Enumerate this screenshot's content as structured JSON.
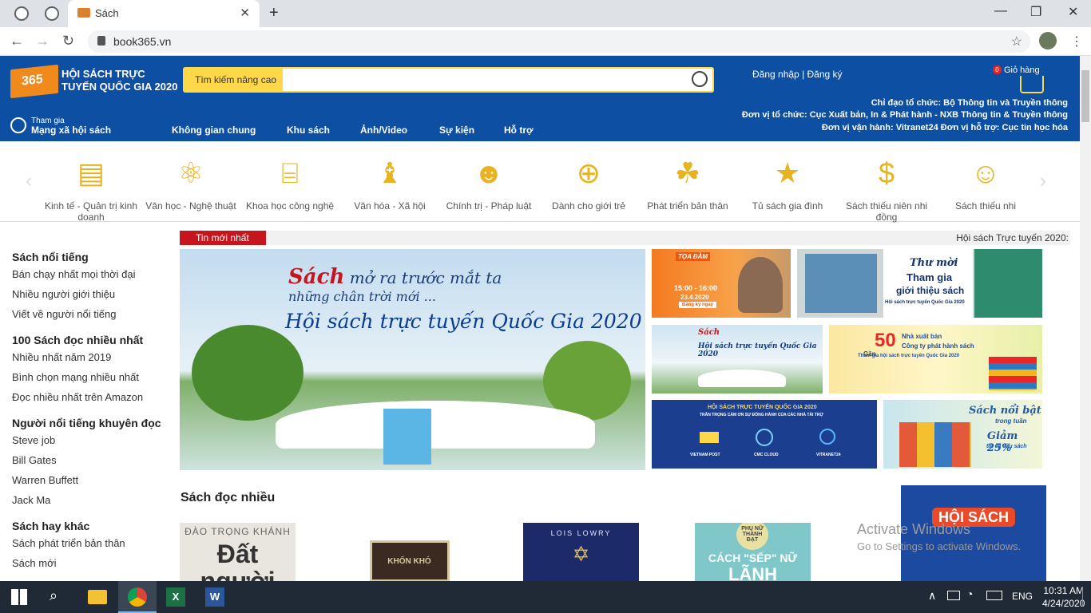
{
  "browser": {
    "tab_title": "Sách",
    "url": "book365.vn"
  },
  "header": {
    "logo": "book365.vn",
    "site_name": "HỘI SÁCH TRỰC TUYẾN QUỐC GIA 2020",
    "adv_search": "Tìm kiếm nâng cao",
    "login": "Đăng nhập",
    "register": "Đăng ký",
    "cart_count": "0",
    "cart_label": "Giỏ hàng",
    "org1": "Chỉ đạo tổ chức: Bộ Thông tin và Truyền thông",
    "org2": "Đơn vị tổ chức: Cục Xuất bản, In & Phát hành - NXB Thông tin & Truyền thông",
    "org3": "Đơn vị vận hành: Vitranet24   Đơn vị hỗ trợ: Cục tin học hóa",
    "join_small": "Tham gia",
    "join_big": "Mạng xã hội sách",
    "nav": [
      "Không gian chung",
      "Khu sách",
      "Ảnh/Video",
      "Sự kiện",
      "Hỗ trợ"
    ]
  },
  "categories": [
    {
      "label": "Kinh tế - Quản trị kinh doanh",
      "icon": "book-icon"
    },
    {
      "label": "Văn học - Nghệ thuật",
      "icon": "atom-icon"
    },
    {
      "label": "Khoa học công nghệ",
      "icon": "column-icon"
    },
    {
      "label": "Văn hóa - Xã hội",
      "icon": "chess-icon"
    },
    {
      "label": "Chính trị - Pháp luật",
      "icon": "person-icon"
    },
    {
      "label": "Dành cho giới trẻ",
      "icon": "globe-book-icon"
    },
    {
      "label": "Phát triển bản thân",
      "icon": "people-icon"
    },
    {
      "label": "Tủ sách gia đình",
      "icon": "star-icon"
    },
    {
      "label": "Sách thiếu niên nhi đồng",
      "icon": "money-hand-icon"
    },
    {
      "label": "Sách thiếu nhi",
      "icon": "mask-icon"
    }
  ],
  "sidebar": {
    "groups": [
      {
        "title": "Sách nổi tiếng",
        "items": [
          "Bán chạy nhất mọi thời đại",
          "Nhiều người giới thiệu",
          "Viết về người nổi tiếng"
        ]
      },
      {
        "title": "100 Sách đọc nhiều nhất",
        "items": [
          "Nhiều nhất năm 2019",
          "Bình chọn mạng nhiều nhất",
          "Đọc nhiều nhất trên Amazon"
        ]
      },
      {
        "title": "Người nổi tiếng khuyên đọc",
        "items": [
          "Steve job",
          "Bill Gates",
          "Warren Buffett",
          "Jack Ma"
        ]
      },
      {
        "title": "Sách hay khác",
        "items": [
          "Sách phát triển bản thân",
          "Sách mới"
        ]
      }
    ]
  },
  "news": {
    "tag": "Tin mới nhất",
    "ticker": "Hội sách Trực tuyến 2020:"
  },
  "hero": {
    "line1_a": "Sách",
    "line1_b": "mở ra trước mắt ta",
    "line2": "những chân trời mới ...",
    "line3": "Hội sách trực tuyến Quốc Gia 2020"
  },
  "tiles": {
    "t1_title": "TỌA ĐÀM",
    "t1_time": "15:00 - 16:00",
    "t1_date": "23.4.2020",
    "t1_btn": "Đăng ký ngay",
    "t2_a": "Thư mời",
    "t2_b": "Tham gia",
    "t2_c": "giới thiệu sách",
    "t2_d": "Hội sách trực tuyến Quốc Gia 2020",
    "t3_a": "Sách",
    "t3_b": "Hội sách trực tuyến Quốc Gia 2020",
    "t4_a": "Gần",
    "t4_b": "50",
    "t4_c": "Nhà xuất bản",
    "t4_d": "Công ty phát hành sách",
    "t4_e": "Tham gia hội sách trực tuyến Quốc Gia 2020",
    "t5_a": "HỘI SÁCH TRỰC TUYẾN QUỐC GIA 2020",
    "t5_b": "TRÂN TRỌNG CẢM ƠN SỰ ĐỒNG HÀNH CỦA CÁC NHÀ TÀI TRỢ",
    "t5_s1": "VIETNAM POST",
    "t5_s2": "CMC CLOUD",
    "t5_s3": "VITRANET24",
    "t6_a": "Sách nổi bật",
    "t6_b": "trong tuần",
    "t6_c": "Giảm 25%",
    "t6_d": "tất cả đầu sách"
  },
  "books": {
    "heading": "Sách đọc nhiều",
    "b1_author": "ĐÀO TRỌNG KHÁNH",
    "b1_title": "Đất người",
    "b2_title": "KHỐN KHÓ",
    "b3_author": "LOIS LOWRY",
    "b4_top": "PHỤ NỮ THÀNH ĐẠT",
    "b4_a": "CÁCH \"SẾP\" NỮ",
    "b4_b": "LÃNH",
    "ad": "HỘI SÁCH"
  },
  "watermark": {
    "line1": "Activate Windows",
    "line2": "Go to Settings to activate Windows."
  },
  "taskbar": {
    "lang": "ENG",
    "time": "10:31 AM",
    "date": "4/24/2020"
  },
  "colors": {
    "header_bg": "#0d4fa2",
    "accent_yellow": "#ffd84a",
    "news_red": "#c4161c",
    "category_gold": "#e7b321"
  }
}
